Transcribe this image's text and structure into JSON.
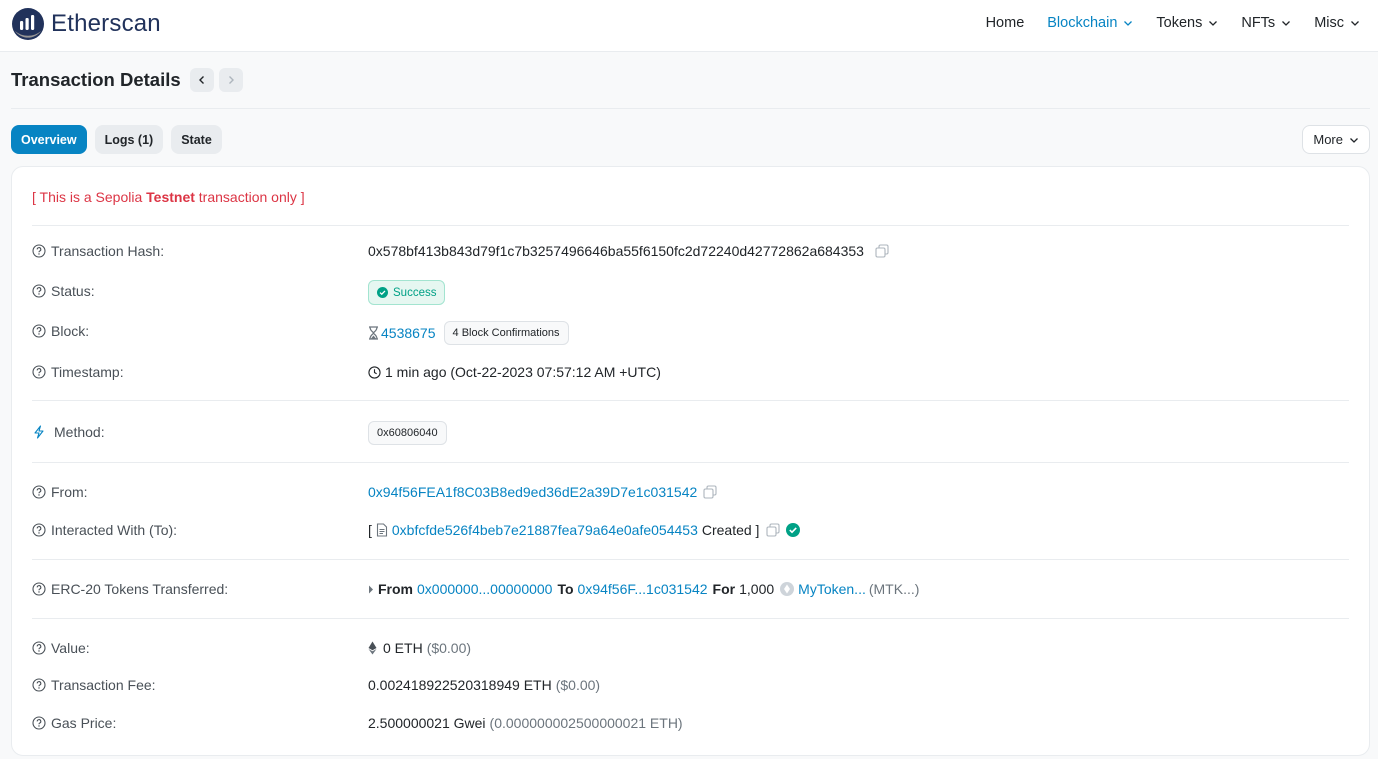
{
  "header": {
    "logo_text": "Etherscan",
    "nav": [
      {
        "label": "Home"
      },
      {
        "label": "Blockchain"
      },
      {
        "label": "Tokens"
      },
      {
        "label": "NFTs"
      },
      {
        "label": "Misc"
      }
    ]
  },
  "page": {
    "title": "Transaction Details"
  },
  "tabs": [
    {
      "label": "Overview"
    },
    {
      "label": "Logs (1)"
    },
    {
      "label": "State"
    }
  ],
  "more_label": "More",
  "notice": {
    "prefix": "[ This is a Sepolia ",
    "bold": "Testnet",
    "suffix": " transaction only ]"
  },
  "details": {
    "tx_hash": {
      "label": "Transaction Hash:",
      "value": "0x578bf413b843d79f1c7b3257496646ba55f6150fc2d72240d42772862a684353"
    },
    "status": {
      "label": "Status:",
      "value": "Success"
    },
    "block": {
      "label": "Block:",
      "value": "4538675",
      "confirmations": "4 Block Confirmations"
    },
    "timestamp": {
      "label": "Timestamp:",
      "value": "1 min ago (Oct-22-2023 07:57:12 AM +UTC)"
    },
    "method": {
      "label": "Method:",
      "value": "0x60806040"
    },
    "from": {
      "label": "From:",
      "value": "0x94f56FEA1f8C03B8ed9ed36dE2a39D7e1c031542"
    },
    "to": {
      "label": "Interacted With (To):",
      "open": "[",
      "address": "0xbfcfde526f4beb7e21887fea79a64e0afe054453",
      "created": "Created ]"
    },
    "erc20": {
      "label": "ERC-20 Tokens Transferred:",
      "from_word": "From",
      "from_addr": "0x000000...00000000",
      "to_word": "To",
      "to_addr": "0x94f56F...1c031542",
      "for_word": "For",
      "amount": "1,000",
      "token_name": "MyToken...",
      "token_symbol": "(MTK...)"
    },
    "value": {
      "label": "Value:",
      "amount": "0 ETH",
      "usd": "($0.00)"
    },
    "fee": {
      "label": "Transaction Fee:",
      "amount": "0.002418922520318949 ETH",
      "usd": "($0.00)"
    },
    "gas_price": {
      "label": "Gas Price:",
      "amount": "2.500000021 Gwei",
      "eth": "(0.000000002500000021 ETH)"
    }
  },
  "colors": {
    "link": "#0784c3",
    "brand": "#21325b",
    "success": "#00a186",
    "danger": "#dc3545"
  }
}
